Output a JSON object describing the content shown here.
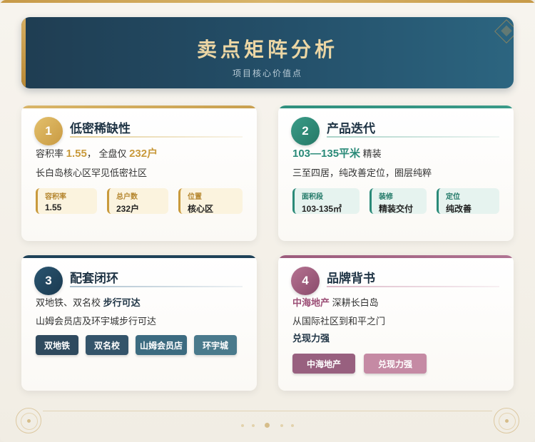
{
  "header": {
    "title": "卖点矩阵分析",
    "subtitle": "项目核心价值点"
  },
  "cards": [
    {
      "number": "1",
      "title": "低密稀缺性",
      "highlight": {
        "p1": "容积率 ",
        "v1": "1.55",
        "p2": "， 全盘仅 ",
        "v2": "232户"
      },
      "desc": "长白岛核心区罕见低密社区",
      "stats": [
        {
          "label": "容积率",
          "value": "1.55"
        },
        {
          "label": "总户数",
          "value": "232户"
        },
        {
          "label": "位置",
          "value": "核心区"
        }
      ],
      "accent": "#d2a94f"
    },
    {
      "number": "2",
      "title": "产品迭代",
      "highlight": {
        "v1": "103—135平米",
        "p1": " 精装"
      },
      "desc": "三至四居，纯改善定位，圈层纯粹",
      "stats": [
        {
          "label": "面积段",
          "value": "103-135㎡"
        },
        {
          "label": "装修",
          "value": "精装交付"
        },
        {
          "label": "定位",
          "value": "纯改善"
        }
      ],
      "accent": "#2a8a78"
    },
    {
      "number": "3",
      "title": "配套闭环",
      "highlight": {
        "p1": "双地铁、双名校 ",
        "v1": "步行可达"
      },
      "desc": "山姆会员店及环宇城步行可达",
      "tags": [
        "双地铁",
        "双名校",
        "山姆会员店",
        "环宇城"
      ],
      "accent": "#1f4258"
    },
    {
      "number": "4",
      "title": "品牌背书",
      "highlight": {
        "v1": "中海地产",
        "p1": " 深耕长白岛"
      },
      "desc": "从国际社区到和平之门",
      "desc2": "兑现力强",
      "tags": [
        "中海地产",
        "兑现力强"
      ],
      "accent": "#9c5b7c"
    }
  ]
}
